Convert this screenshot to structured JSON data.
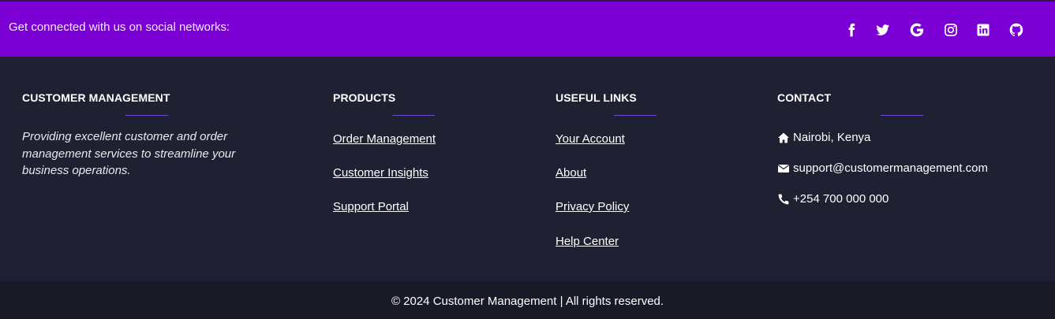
{
  "social": {
    "prompt": "Get connected with us on social networks:",
    "icons": [
      "facebook-icon",
      "twitter-icon",
      "google-icon",
      "instagram-icon",
      "linkedin-icon",
      "github-icon"
    ],
    "bar_color": "#7a00d3"
  },
  "footer": {
    "about": {
      "title": "CUSTOMER MANAGEMENT",
      "text": "Providing excellent customer and order management services to streamline your business operations."
    },
    "products": {
      "title": "PRODUCTS",
      "links": [
        "Order Management",
        "Customer Insights",
        "Support Portal"
      ]
    },
    "useful_links": {
      "title": "USEFUL LINKS",
      "links": [
        "Your Account",
        "About",
        "Privacy Policy",
        "Help Center"
      ]
    },
    "contact": {
      "title": "CONTACT",
      "address": "Nairobi, Kenya",
      "email": "support@customermanagement.com",
      "phone": "+254 700 000 000"
    },
    "accent_color": "#6d4ccf",
    "background_color": "#1f2132"
  },
  "bottom": {
    "copyright": "© 2024 Customer Management | All rights reserved."
  }
}
